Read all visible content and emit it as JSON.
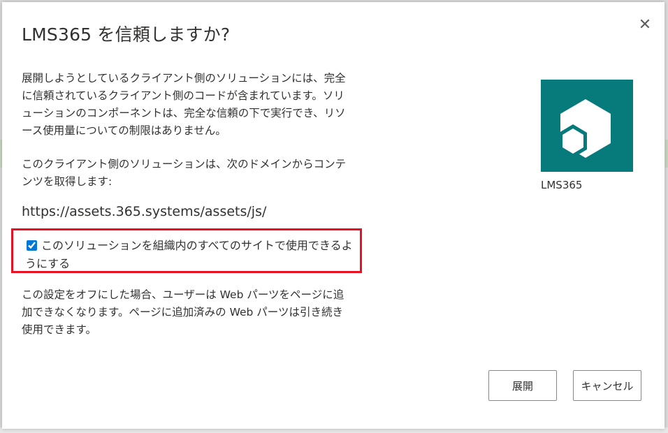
{
  "dialog": {
    "title": "LMS365 を信頼しますか?",
    "close_glyph": "✕",
    "paragraph1": "展開しようとしているクライアント側のソリューションには、完全に信頼されているクライアント側のコードが含まれています。ソリューションのコンポーネントは、完全な信頼の下で実行でき、リソース使用量についての制限はありません。",
    "paragraph2": "このクライアント側のソリューションは、次のドメインからコンテンツを取得します:",
    "domain_url": "https://assets.365.systems/assets/js/",
    "checkbox": {
      "label": "このソリューションを組織内のすべてのサイトで使用できるようにする",
      "checked": true
    },
    "paragraph3": "この設定をオフにした場合、ユーザーは Web パーツをページに追加できなくなります。ページに追加済みの Web パーツは引き続き使用できます。",
    "app": {
      "name": "LMS365",
      "icon": "lms365-hexagon-logo-icon",
      "icon_bg_color": "#077a7c"
    },
    "buttons": {
      "deploy": "展開",
      "cancel": "キャンセル"
    },
    "highlight_color": "#e81123"
  }
}
